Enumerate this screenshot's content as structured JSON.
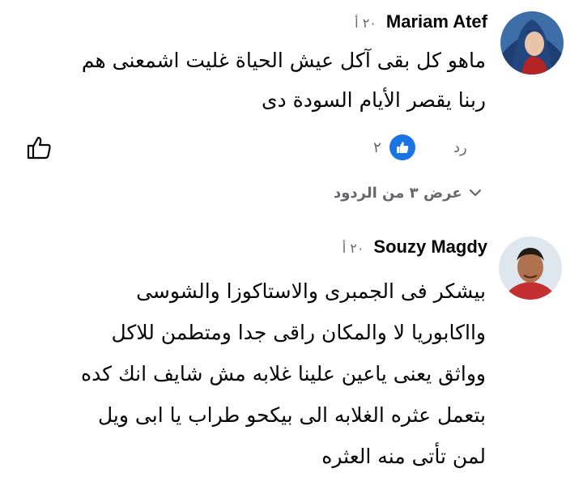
{
  "colors": {
    "accent": "#1b74e4",
    "meta": "#65676b",
    "text": "#050505"
  },
  "comments": [
    {
      "author": "Mariam Atef",
      "time": "٢٠ أ",
      "text": "ماهو كل بقى آكل عيش الحياة غليت اشمعنى هم\nربنا يقصر الأيام السودة دى",
      "reply_label": "رد",
      "reaction_count": "٢",
      "reaction_icon": "like-reaction-icon",
      "view_replies_label": "عرض ٣ من الردود"
    },
    {
      "author": "Souzy Magdy",
      "time": "٢٠ أ",
      "text": "بيشكر فى الجمبرى والاستاكوزا والشوسى\nوااكابوريا لا والمكان راقى جدا ومتطمن للاكل\nوواثق يعنى ياعين علينا غلابه مش شايف انك كده\nبتعمل عثره الغلابه الى بيكحو طراب يا ابى ويل\nلمن تأتى منه العثره"
    }
  ]
}
